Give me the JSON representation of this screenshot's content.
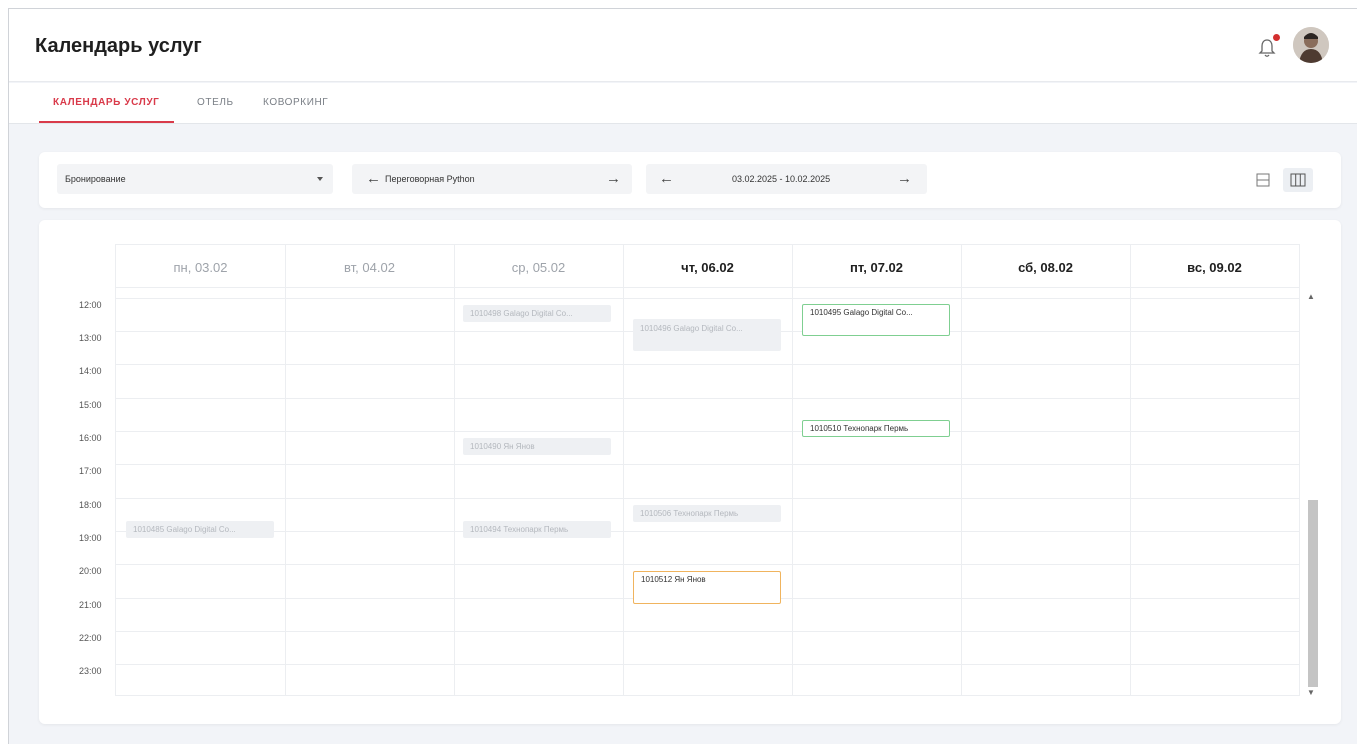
{
  "header": {
    "title": "Календарь услуг"
  },
  "tabs": [
    {
      "label": "Календарь услуг"
    },
    {
      "label": "Отель"
    },
    {
      "label": "Коворкинг"
    }
  ],
  "toolbar": {
    "type_select": "Бронирование",
    "room": "Переговорная Python",
    "date_range": "03.02.2025 - 10.02.2025"
  },
  "colors": {
    "accent": "#d93a4a",
    "confirmed": "#7fcf91",
    "pending": "#f0b45e"
  },
  "calendar": {
    "days": [
      "пн, 03.02",
      "вт, 04.02",
      "ср, 05.02",
      "чт, 06.02",
      "пт, 07.02",
      "сб, 08.02",
      "вс, 09.02"
    ],
    "times": [
      "12:00",
      "13:00",
      "14:00",
      "15:00",
      "16:00",
      "17:00",
      "18:00",
      "19:00",
      "20:00",
      "21:00",
      "22:00",
      "23:00"
    ],
    "events": [
      {
        "label": "1010498 Galago Digital Co...",
        "status": "past"
      },
      {
        "label": "1010496 Galago Digital Co...",
        "status": "past"
      },
      {
        "label": "1010495 Galago Digital Co...",
        "status": "confirmed"
      },
      {
        "label": "1010510 Технопарк Пермь",
        "status": "confirmed"
      },
      {
        "label": "1010490 Ян Янов",
        "status": "past"
      },
      {
        "label": "1010506 Технопарк Пермь",
        "status": "past"
      },
      {
        "label": "1010485 Galago Digital Co...",
        "status": "past"
      },
      {
        "label": "1010494 Технопарк Пермь",
        "status": "past"
      },
      {
        "label": "1010512 Ян Янов",
        "status": "pending"
      }
    ]
  }
}
